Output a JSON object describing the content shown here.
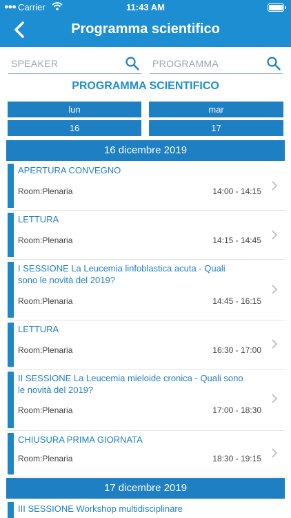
{
  "status_bar": {
    "carrier": "Carrier",
    "time": "11:43 AM"
  },
  "nav": {
    "title": "Programma scientifico"
  },
  "search": {
    "speaker_placeholder": "SPEAKER",
    "program_placeholder": "PROGRAMMA"
  },
  "section_title": "PROGRAMMA SCIENTIFICO",
  "days": [
    {
      "weekday": "lun",
      "date": "16"
    },
    {
      "weekday": "mar",
      "date": "17"
    }
  ],
  "groups": [
    {
      "date_label": "16 dicembre 2019",
      "sessions": [
        {
          "title": "APERTURA CONVEGNO",
          "room": "Room:Plenaria",
          "time": "14:00 - 14:15"
        },
        {
          "title": "LETTURA",
          "room": "Room:Plenaria",
          "time": "14:15 - 14:45"
        },
        {
          "title": "I SESSIONE La Leucemia linfoblastica acuta - Quali sono le novità del 2019?",
          "room": "Room:Plenaria",
          "time": "14:45 - 16:15"
        },
        {
          "title": "LETTURA",
          "room": "Room:Plenaria",
          "time": "16:30 - 17:00"
        },
        {
          "title": "II SESSIONE La Leucemia mieloide cronica - Quali sono le novità del 2019?",
          "room": "Room:Plenaria",
          "time": "17:00 - 18:30"
        },
        {
          "title": "CHIUSURA PRIMA GIORNATA",
          "room": "Room:Plenaria",
          "time": "18:30 - 19:15"
        }
      ]
    },
    {
      "date_label": "17 dicembre 2019",
      "sessions": [
        {
          "title": "III SESSIONE Workshop multidisciplinare"
        }
      ]
    }
  ],
  "colors": {
    "header": "#1d8ed2",
    "accent": "#1e7fc2",
    "bar": "#1e88c7"
  }
}
